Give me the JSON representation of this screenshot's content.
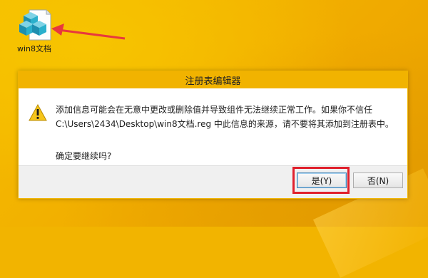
{
  "desktop": {
    "file_icon_name": "registry-file-icon",
    "file_label": "win8文档"
  },
  "dialog": {
    "title": "注册表编辑器",
    "message_line1": "添加信息可能会在无意中更改或删除值并导致组件无法继续正常工作。如果你不信任",
    "message_line2": "C:\\Users\\2434\\Desktop\\win8文档.reg 中此信息的来源，请不要将其添加到注册表中。",
    "confirm_question": "确定要继续吗?",
    "yes_label": "是(Y)",
    "no_label": "否(N)"
  },
  "colors": {
    "desktop_background": "#f2b400",
    "titlebar": "#f1b300",
    "highlight_box": "#e0202d",
    "arrow": "#e8383d"
  }
}
